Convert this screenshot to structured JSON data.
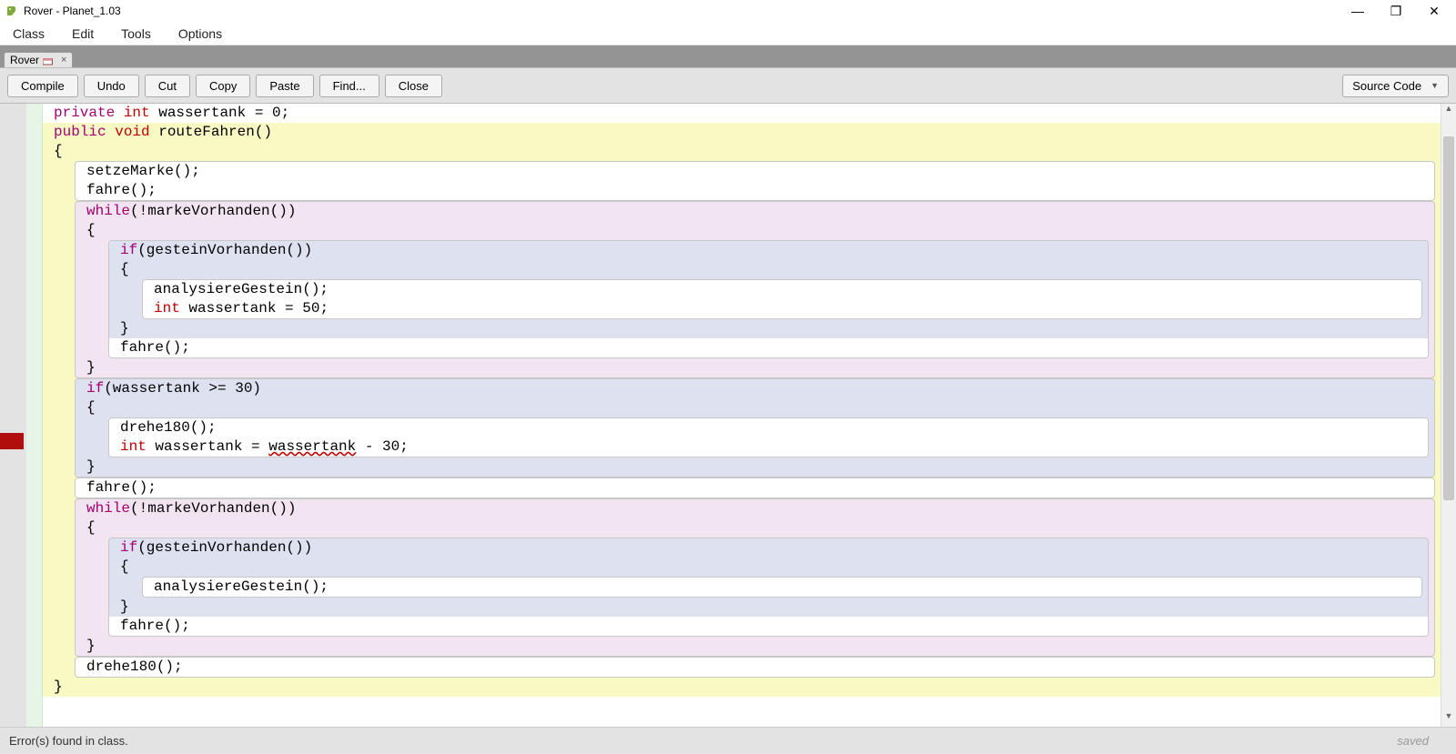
{
  "window": {
    "title": "Rover - Planet_1.03"
  },
  "menubar": {
    "items": [
      "Class",
      "Edit",
      "Tools",
      "Options"
    ]
  },
  "tab": {
    "label": "Rover",
    "close": "×"
  },
  "toolbar": {
    "compile": "Compile",
    "undo": "Undo",
    "cut": "Cut",
    "copy": "Copy",
    "paste": "Paste",
    "find": "Find...",
    "close": "Close",
    "viewmode": "Source Code"
  },
  "code": {
    "l1a": "private",
    "l1b": " int",
    "l1c": " wassertank = 0;",
    "l2a": "public",
    "l2b": " void",
    "l2c": " routeFahren()",
    "l3": "{",
    "l4": "setzeMarke();",
    "l5": "fahre();",
    "l6a": "while",
    "l6b": "(!markeVorhanden())",
    "l7": "{",
    "l8a": "if",
    "l8b": "(gesteinVorhanden())",
    "l9": "{",
    "l10": "analysiereGestein();",
    "l11a": "int",
    "l11b": " wassertank = 50;",
    "l12": "}",
    "l13": "fahre();",
    "l14": "}",
    "l15a": "if",
    "l15b": "(wassertank >= 30)",
    "l16": "{",
    "l17": "drehe180();",
    "l18a": "int",
    "l18b": " wassertank = ",
    "l18c": "wassertank",
    "l18d": " - 30;",
    "l19": "",
    "l20": "}",
    "l21": "fahre();",
    "l22a": "while",
    "l22b": "(!markeVorhanden())",
    "l23": "{",
    "l24a": "if",
    "l24b": "(gesteinVorhanden())",
    "l25": "{",
    "l26": "analysiereGestein();",
    "l27": "}",
    "l28": "fahre();",
    "l29": "}",
    "l30": "drehe180();",
    "l31": "}"
  },
  "status": {
    "left": "Error(s) found in class.",
    "right": "saved"
  }
}
